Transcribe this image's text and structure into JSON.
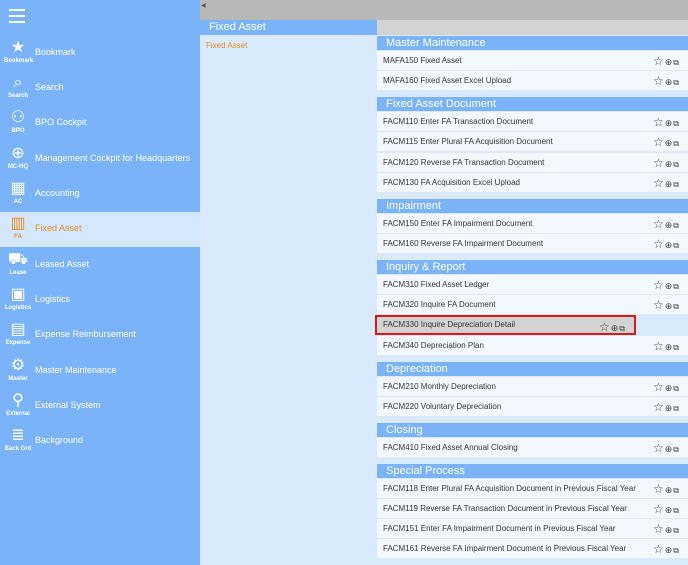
{
  "sidebar": {
    "menu_icon": "hamburger-icon",
    "items": [
      {
        "label": "Bookmark",
        "abbr": "Bookmark",
        "icon": "star-icon",
        "glyph": "★"
      },
      {
        "label": "Search",
        "abbr": "Search",
        "icon": "search-icon",
        "glyph": "⌕"
      },
      {
        "label": "BPO Cockpit",
        "abbr": "BPO",
        "icon": "people-icon",
        "glyph": "⚇"
      },
      {
        "label": "Management Cockpit for Headquarters",
        "abbr": "MC-HQ",
        "icon": "globe-icon",
        "glyph": "⊕"
      },
      {
        "label": "Accounting",
        "abbr": "AC",
        "icon": "calculator-icon",
        "glyph": "▦"
      },
      {
        "label": "Fixed Asset",
        "abbr": "FA",
        "icon": "building-icon",
        "glyph": "▥"
      },
      {
        "label": "Leased Asset",
        "abbr": "Lease",
        "icon": "truck-icon",
        "glyph": "⛟"
      },
      {
        "label": "Logistics",
        "abbr": "Logistics",
        "icon": "box-icon",
        "glyph": "▣"
      },
      {
        "label": "Expense Reimbursement",
        "abbr": "Expense",
        "icon": "briefcase-icon",
        "glyph": "▤"
      },
      {
        "label": "Master Maintenance",
        "abbr": "Master",
        "icon": "gear-icon",
        "glyph": "⚙"
      },
      {
        "label": "External System",
        "abbr": "External",
        "icon": "link-icon",
        "glyph": "⚲"
      },
      {
        "label": "Background",
        "abbr": "Back Grd",
        "icon": "database-icon",
        "glyph": "≣"
      }
    ],
    "active_index": 5
  },
  "middle": {
    "title": "Fixed Asset",
    "link": "Fixed Asset"
  },
  "icons": {
    "star": "☆",
    "plus": "⊕",
    "window": "⧉"
  },
  "sections": [
    {
      "title": "Master Maintenance",
      "items": [
        "MAFA150 Fixed Asset",
        "MAFA160 Fixed Asset Excel Upload"
      ]
    },
    {
      "title": "Fixed Asset Document",
      "items": [
        "FACM110 Enter FA Transaction Document",
        "FACM115 Enter Plural FA Acquisition Document",
        "FACM120 Reverse FA Transaction Document",
        "FACM130 FA Acquisition Excel Upload"
      ]
    },
    {
      "title": "Impairment",
      "items": [
        "FACM150 Enter FA Impairment Document",
        "FACM160 Reverse FA Impairment Document"
      ]
    },
    {
      "title": "Inquiry & Report",
      "items": [
        "FACM310 Fixed Asset Ledger",
        "FACM320 Inquire FA Document",
        "FACM330 Inquire Depreciation Detail",
        "FACM340 Depreciation Plan"
      ]
    },
    {
      "title": "Depreciation",
      "items": [
        "FACM210 Monthly Depreciation",
        "FACM220 Voluntary Depreciation"
      ]
    },
    {
      "title": "Closing",
      "items": [
        "FACM410 Fixed Asset Annual Closing"
      ]
    },
    {
      "title": "Special Process",
      "items": [
        "FACM118 Enter Plural FA Acquisition Document in Previous Fiscal Year",
        "FACM119 Reverse FA Transaction Document in Previous Fiscal Year",
        "FACM151 Enter FA Impairment Document in Previous Fiscal Year",
        "FACM161 Reverse FA Impairment Document in Previous Fiscal Year"
      ]
    }
  ],
  "selected_item": "FACM330 Inquire Depreciation Detail"
}
